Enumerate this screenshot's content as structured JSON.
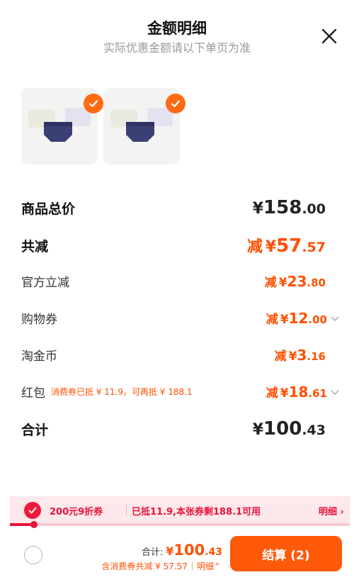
{
  "header": {
    "title": "金额明细",
    "subtitle": "实际优惠金额请以下单页为准",
    "close_icon": "close-icon"
  },
  "products": [
    {
      "name": "product-thumbnail-1",
      "selected": true
    },
    {
      "name": "product-thumbnail-2",
      "selected": true
    }
  ],
  "rows": {
    "goods_total": {
      "label": "商品总价",
      "yen": "¥",
      "int": "158",
      "dec": ".00"
    },
    "total_discount": {
      "label": "共减",
      "prefix": "减",
      "yen": "¥",
      "int": "57",
      "dec": ".57"
    },
    "official": {
      "label": "官方立减",
      "prefix": "减",
      "yen": "¥",
      "int": "23",
      "dec": ".80"
    },
    "shopping_coupon": {
      "label": "购物券",
      "prefix": "减",
      "yen": "¥",
      "int": "12",
      "dec": ".00"
    },
    "taojinbi": {
      "label": "淘金币",
      "prefix": "减",
      "yen": "¥",
      "int": "3",
      "dec": ".16"
    },
    "redpack": {
      "label": "红包",
      "note": "消费券已抵 ¥ 11.9，可再抵 ¥ 188.1",
      "prefix": "减",
      "yen": "¥",
      "int": "18",
      "dec": ".61"
    },
    "sum": {
      "label": "合计",
      "yen": "¥",
      "int": "100",
      "dec": ".43"
    }
  },
  "coupon_bar": {
    "title": "200元9折券",
    "desc": "已抵11.9,本张券剩188.1可用",
    "detail": "明细 ›",
    "progress": 0.07
  },
  "bottom": {
    "total_label": "合计:",
    "total_yen": "¥",
    "total_int": "100",
    "total_dec": ".43",
    "sub_text": "含消费券共减 ¥ 57.57",
    "detail_toggle": "明细⌃",
    "checkout_label": "结算 (2)"
  },
  "colors": {
    "accent_orange": "#ff5000",
    "checkout_button": "#ff5a0a",
    "coupon_red": "#e8143a",
    "coupon_bg": "#fde8ec"
  }
}
